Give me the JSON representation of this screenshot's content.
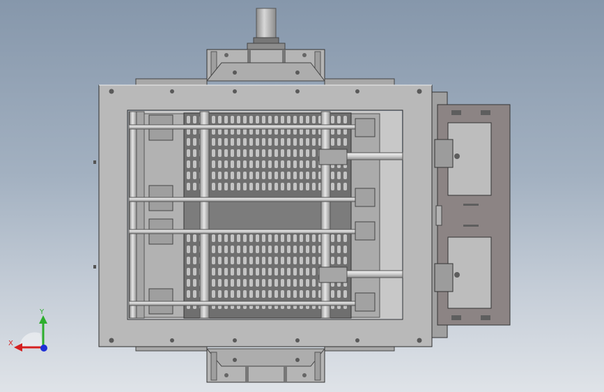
{
  "scene": {
    "background_top": "#8697ab",
    "background_bottom": "#dfe3e8",
    "frame_color": "#b7b7b7",
    "plate_color": "#9a9a9a",
    "grate_color": "#8e8e8e",
    "actuator_panel_color": "#8c8484",
    "rod_color": "#dcdcdc"
  },
  "triad": {
    "x_label": "X",
    "y_label": "Y",
    "x_color": "#d42020",
    "y_color": "#2dae2d",
    "z_color": "#1e30d6"
  }
}
